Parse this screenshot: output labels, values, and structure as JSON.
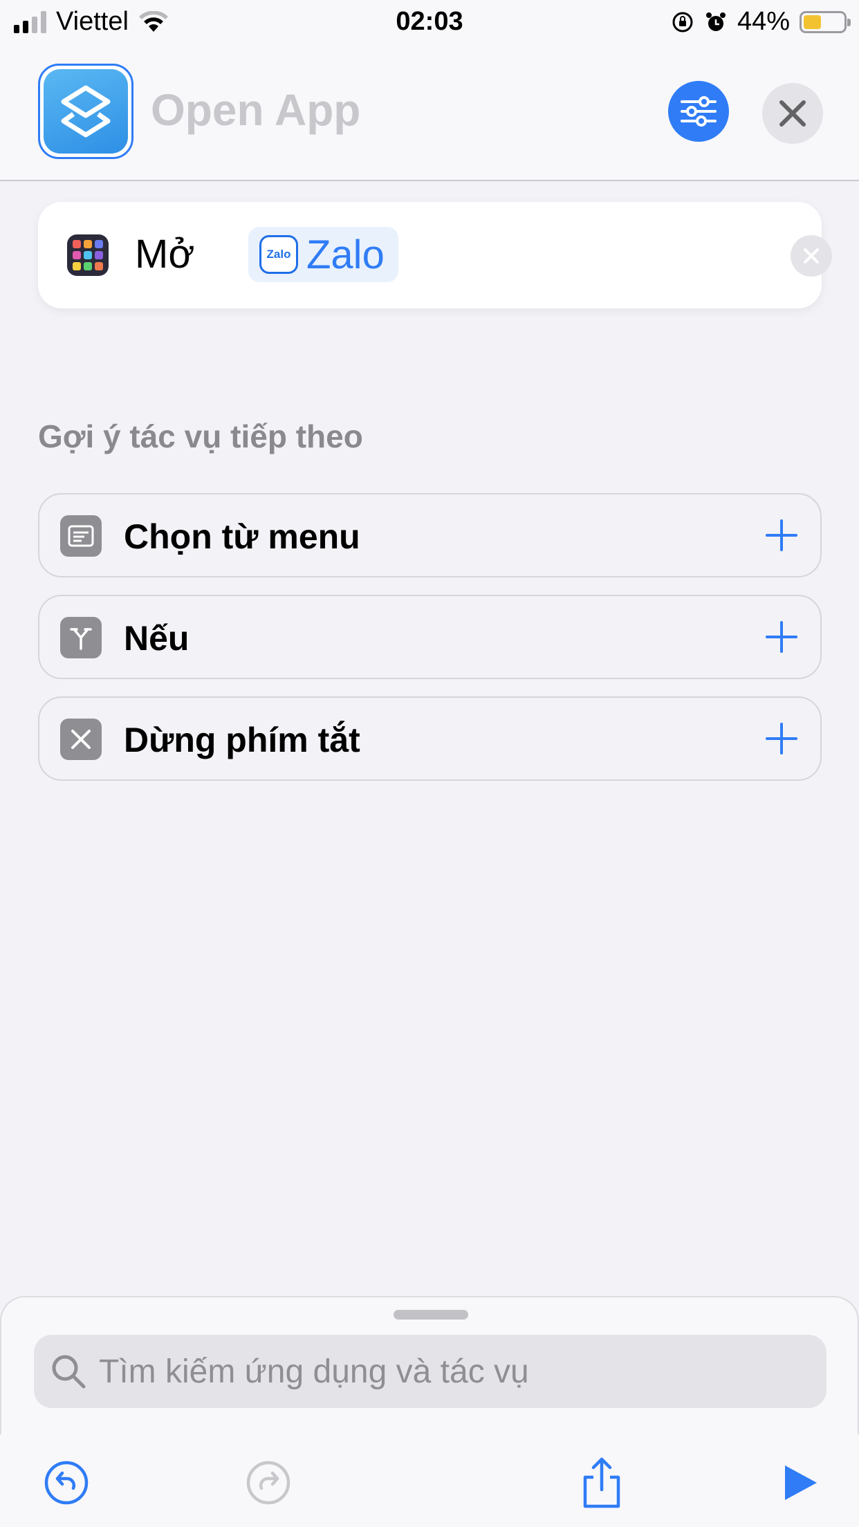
{
  "status_bar": {
    "carrier": "Viettel",
    "time": "02:03",
    "battery_percent": "44%"
  },
  "header": {
    "title": "Open App",
    "icons": [
      "shortcuts-app-icon",
      "sliders-icon",
      "close-icon"
    ]
  },
  "action": {
    "verb": "Mở",
    "app_name": "Zalo",
    "app_logo_text": "Zalo"
  },
  "suggestions": {
    "label": "Gợi ý tác vụ tiếp theo",
    "items": [
      {
        "label": "Chọn từ menu",
        "icon": "menu-icon"
      },
      {
        "label": "Nếu",
        "icon": "branch-icon"
      },
      {
        "label": "Dừng phím tắt",
        "icon": "stop-x-icon"
      }
    ]
  },
  "search": {
    "placeholder": "Tìm kiếm ứng dụng và tác vụ"
  },
  "toolbar": {
    "icons": [
      "undo-icon",
      "redo-icon",
      "share-icon",
      "play-icon"
    ]
  },
  "colors": {
    "accent": "#2f7cf6",
    "background": "#f2f2f7",
    "battery": "#f2c230"
  }
}
